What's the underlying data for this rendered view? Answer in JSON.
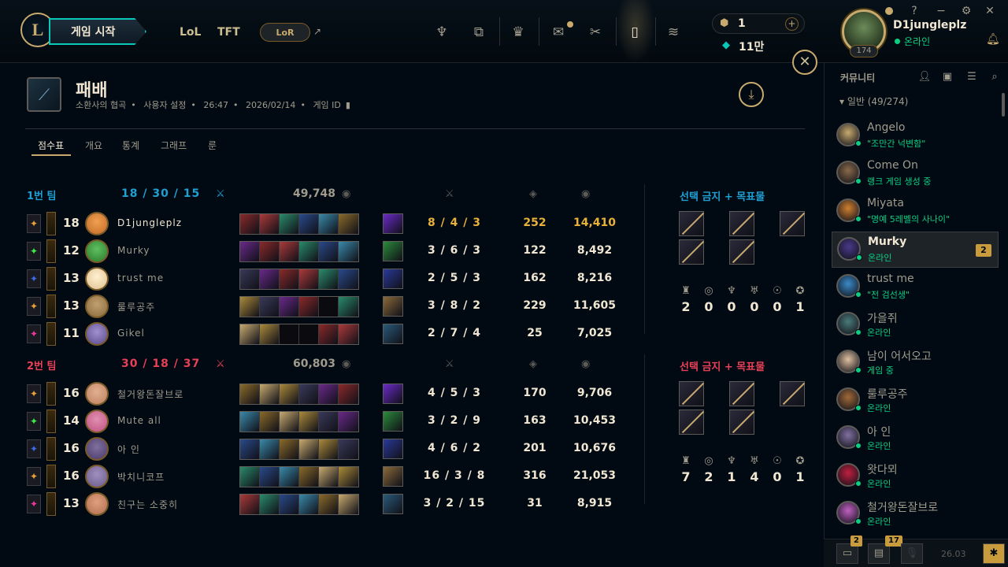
{
  "topnav": {
    "play_label": "게임 시작",
    "lol_label": "LoL",
    "tft_label": "TFT",
    "lor_label": "LoR",
    "ext_arrow": "↗",
    "icons": [
      "trophy-icon",
      "collection-icon",
      "loot-icon",
      "store-icon",
      "clash-icon",
      "match-history-icon",
      "coins-icon"
    ]
  },
  "currency": {
    "rp": "1",
    "be": "11만",
    "plus": "+"
  },
  "profile": {
    "name": "D1jungleplz",
    "status": "온라인",
    "level": "174"
  },
  "window": {
    "help": "?",
    "minimize": "−",
    "settings": "⚙",
    "close": "✕"
  },
  "game": {
    "result": "패배",
    "map": "소환사의 협곡",
    "mode": "사용자 설정",
    "duration": "26:47",
    "date": "2026/02/14",
    "id_label": "게임 ID"
  },
  "tabs": [
    "점수표",
    "개요",
    "통계",
    "그래프",
    "룬"
  ],
  "teams": [
    {
      "label": "1번 팀",
      "kills": "18",
      "deaths": "30",
      "assists": "15",
      "gold": "49,748",
      "bans_title": "선택 금지 + 목표물",
      "objectives": [
        "2",
        "0",
        "0",
        "0",
        "0",
        "1"
      ],
      "players": [
        {
          "level": "18",
          "name": "D1jungleplz",
          "k": "8",
          "d": "4",
          "a": "3",
          "cs": "252",
          "gold": "14,410",
          "me": true
        },
        {
          "level": "12",
          "name": "Murky",
          "k": "3",
          "d": "6",
          "a": "3",
          "cs": "122",
          "gold": "8,492"
        },
        {
          "level": "13",
          "name": "trust me",
          "k": "2",
          "d": "5",
          "a": "3",
          "cs": "162",
          "gold": "8,216"
        },
        {
          "level": "13",
          "name": "룰루공주",
          "k": "3",
          "d": "8",
          "a": "2",
          "cs": "229",
          "gold": "11,605"
        },
        {
          "level": "11",
          "name": "Gikel",
          "k": "2",
          "d": "7",
          "a": "4",
          "cs": "25",
          "gold": "7,025"
        }
      ]
    },
    {
      "label": "2번 팀",
      "kills": "30",
      "deaths": "18",
      "assists": "37",
      "gold": "60,803",
      "bans_title": "선택 금지 + 목표물",
      "objectives": [
        "7",
        "2",
        "1",
        "4",
        "0",
        "1"
      ],
      "players": [
        {
          "level": "16",
          "name": "철거왕돈잘브로",
          "k": "4",
          "d": "5",
          "a": "3",
          "cs": "170",
          "gold": "9,706"
        },
        {
          "level": "14",
          "name": "Mute all",
          "k": "3",
          "d": "2",
          "a": "9",
          "cs": "163",
          "gold": "10,453"
        },
        {
          "level": "16",
          "name": "아 인",
          "k": "4",
          "d": "6",
          "a": "2",
          "cs": "201",
          "gold": "10,676"
        },
        {
          "level": "16",
          "name": "박치니코프",
          "k": "16",
          "d": "3",
          "a": "8",
          "cs": "316",
          "gold": "21,053"
        },
        {
          "level": "13",
          "name": "친구는 소중히",
          "k": "3",
          "d": "2",
          "a": "15",
          "cs": "31",
          "gold": "8,915"
        }
      ]
    }
  ],
  "social": {
    "title": "커뮤니티",
    "group": "일반 (49/274)",
    "friends": [
      {
        "name": "Angelo",
        "status": "\"조만간 넉변함\""
      },
      {
        "name": "Come On",
        "status": "랭크 게임 생성 중"
      },
      {
        "name": "Miyata",
        "status": "\"명예 5레벨의 사나이\""
      },
      {
        "name": "Murky",
        "status": "온라인",
        "badge": "2"
      },
      {
        "name": "trust me",
        "status": "\"전 검선생\""
      },
      {
        "name": "가을쥐",
        "status": "온라인"
      },
      {
        "name": "남이 어서오고",
        "status": "게임 중"
      },
      {
        "name": "룰루공주",
        "status": "온라인"
      },
      {
        "name": "아 인",
        "status": "온라인"
      },
      {
        "name": "왓다뫼",
        "status": "온라인"
      },
      {
        "name": "철거왕돈잘브로",
        "status": "온라인"
      }
    ]
  },
  "bottom": {
    "chat_badge": "2",
    "missions_badge": "17",
    "version": "26.03"
  },
  "colors": {
    "gold": "#c8aa6e",
    "teal": "#0ac8b9",
    "blue_team": "#1ea0d2",
    "red_team": "#e84057",
    "online": "#0acf83",
    "highlight": "#e8b13a"
  }
}
